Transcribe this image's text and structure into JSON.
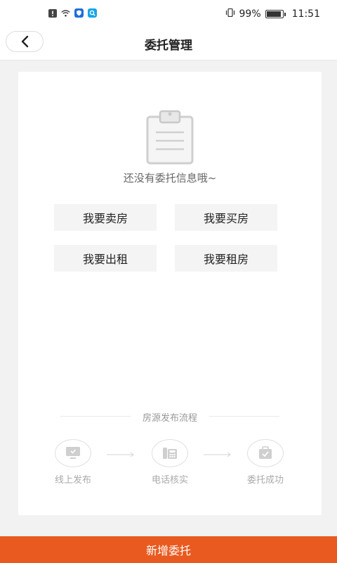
{
  "status_bar": {
    "battery": "99%",
    "battery_level": 0.99,
    "time": "11:51"
  },
  "header": {
    "title": "委托管理"
  },
  "empty_state": {
    "icon": "clipboard-icon",
    "message": "还没有委托信息哦~"
  },
  "actions": [
    {
      "label": "我要卖房"
    },
    {
      "label": "我要买房"
    },
    {
      "label": "我要出租"
    },
    {
      "label": "我要租房"
    }
  ],
  "process": {
    "title": "房源发布流程",
    "steps": [
      {
        "label": "线上发布",
        "icon": "monitor-icon"
      },
      {
        "label": "电话核实",
        "icon": "phone-icon"
      },
      {
        "label": "委托成功",
        "icon": "briefcase-check-icon"
      }
    ]
  },
  "footer": {
    "button_label": "新增委托"
  },
  "colors": {
    "accent": "#e85a1f",
    "background": "#f2f2f2"
  }
}
